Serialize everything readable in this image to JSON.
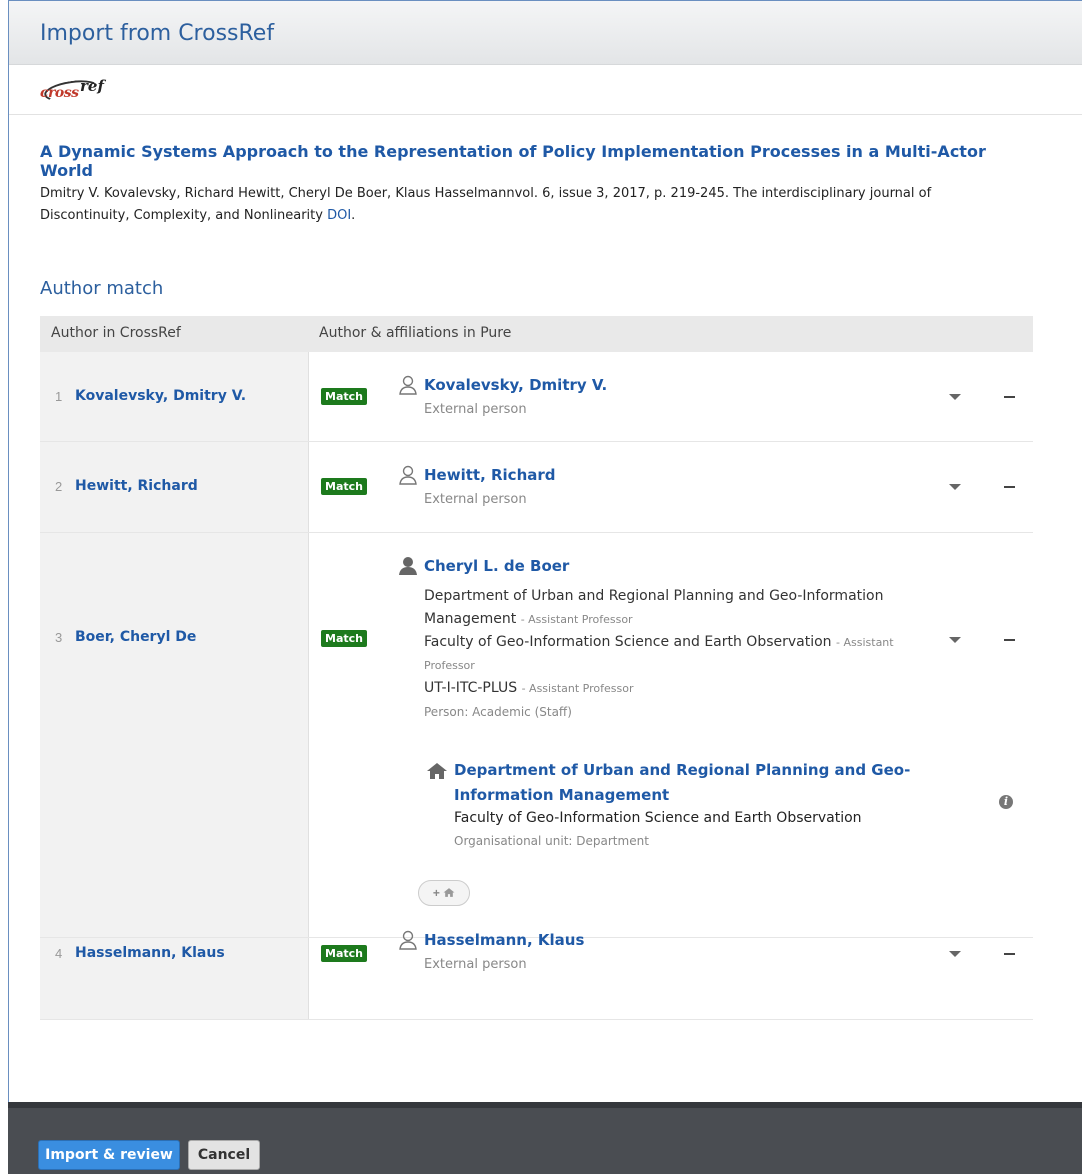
{
  "dialog": {
    "title": "Import from CrossRef",
    "logo": {
      "part1": "cross",
      "part2": "ref"
    }
  },
  "publication": {
    "title": "A Dynamic Systems Approach to the Representation of Policy Implementation Processes in a Multi-Actor World",
    "description": "Dmitry V. Kovalevsky, Richard Hewitt, Cheryl De Boer, Klaus Hasselmannvol. 6, issue 3, 2017, p. 219-245. The interdisciplinary journal of Discontinuity, Complexity, and Nonlinearity ",
    "doi_link": "DOI",
    "doi_suffix": "."
  },
  "author_match": {
    "section_title": "Author match",
    "col_crossref": "Author in CrossRef",
    "col_pure": "Author & affiliations in Pure",
    "match_label": "Match",
    "rows": [
      {
        "num": "1",
        "crossref_name": "Kovalevsky, Dmitry V.",
        "pure_name": "Kovalevsky, Dmitry V.",
        "pure_type": "External person"
      },
      {
        "num": "2",
        "crossref_name": "Hewitt, Richard",
        "pure_name": "Hewitt, Richard",
        "pure_type": "External person"
      },
      {
        "num": "3",
        "crossref_name": "Boer, Cheryl De",
        "pure_name": "Cheryl L. de Boer",
        "affiliations": [
          {
            "org": "Department of Urban and Regional Planning and Geo-Information Management",
            "role": "Assistant Professor"
          },
          {
            "org": "Faculty of Geo-Information Science and Earth Observation",
            "role": "Assistant Professor"
          },
          {
            "org": "UT-I-ITC-PLUS",
            "role": "Assistant Professor"
          }
        ],
        "pure_type": "Person: Academic (Staff)",
        "org_unit": {
          "title": "Department of Urban and Regional Planning and Geo-Information Management",
          "parent": "Faculty of Geo-Information Science and Earth Observation",
          "type": "Organisational unit: Department"
        },
        "add_org_label": "+"
      },
      {
        "num": "4",
        "crossref_name": "Hasselmann, Klaus",
        "pure_name": "Hasselmann, Klaus",
        "pure_type": "External person"
      }
    ]
  },
  "footer": {
    "import_label": "Import & review",
    "cancel_label": "Cancel"
  },
  "colors": {
    "accent": "#1f59a6",
    "match_badge": "#1d7a1d",
    "primary_button": "#3a8ee0",
    "footer_bg": "#4a4d52"
  },
  "icons": {
    "external_person": "person-outline-icon",
    "internal_person": "person-solid-icon",
    "org_unit": "house-icon",
    "info": "info-icon",
    "dropdown": "caret-down-icon",
    "remove": "minus-icon"
  }
}
